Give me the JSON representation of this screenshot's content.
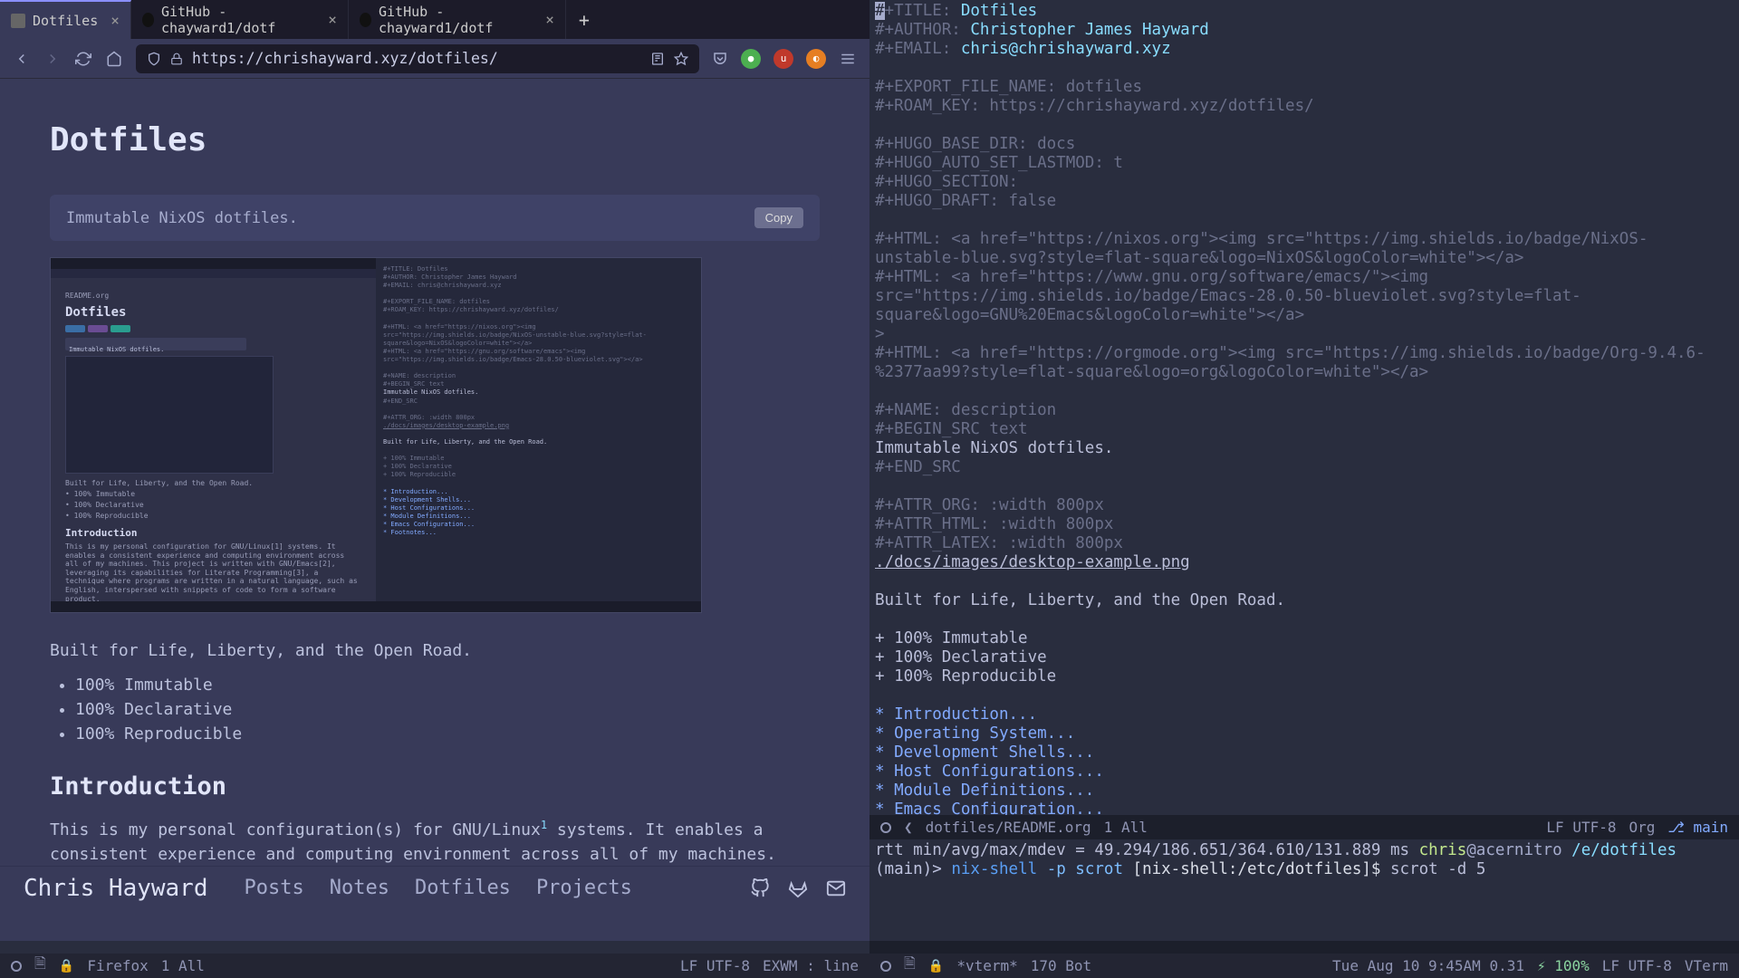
{
  "browser": {
    "tabs": [
      {
        "title": "Dotfiles",
        "active": true
      },
      {
        "title": "GitHub - chayward1/dotf",
        "active": false
      },
      {
        "title": "GitHub - chayward1/dotf",
        "active": false
      }
    ],
    "url": "https://chrishayward.xyz/dotfiles/"
  },
  "page": {
    "title": "Dotfiles",
    "desc": "Immutable NixOS dotfiles.",
    "copy_label": "Copy",
    "tagline": "Built for Life, Liberty, and the Open Road.",
    "bullets": [
      "100% Immutable",
      "100% Declarative",
      "100% Reproducible"
    ],
    "intro_heading": "Introduction",
    "intro_body_a": "This is my personal configuration(s) for GNU/Linux",
    "intro_sup": "1",
    "intro_body_b": " systems. It enables a consistent experience and computing environment across all of my machines. This"
  },
  "site_nav": {
    "brand": "Chris Hayward",
    "links": [
      "Posts",
      "Notes",
      "Dotfiles",
      "Projects"
    ]
  },
  "mini": {
    "readme": "README.org",
    "title": "Dotfiles",
    "desc": "Immutable NixOS dotfiles.",
    "tagline": "Built for Life, Liberty, and the Open Road.",
    "b1": "• 100% Immutable",
    "b2": "• 100% Declarative",
    "b3": "• 100% Reproducible",
    "intro": "Introduction",
    "para": "This is my personal configuration for GNU/Linux[1] systems. It enables a consistent experience and computing environment across all of my machines. This project is written with GNU/Emacs[2], leveraging its capabilities for Literate Programming[3], a technique where programs are written in a natural language, such as English, interspersed with snippets of code to form a software product."
  },
  "editor": {
    "title_key": "#+TITLE:",
    "title_val": "Dotfiles",
    "author_key": "#+AUTHOR:",
    "author_val": "Christopher James Hayward",
    "email_key": "#+EMAIL:",
    "email_val": "chris@chrishayward.xyz",
    "export": "#+EXPORT_FILE_NAME: dotfiles",
    "roam": "#+ROAM_KEY: https://chrishayward.xyz/dotfiles/",
    "hugo_base": "#+HUGO_BASE_DIR: docs",
    "hugo_last": "#+HUGO_AUTO_SET_LASTMOD: t",
    "hugo_section": "#+HUGO_SECTION:",
    "hugo_draft": "#+HUGO_DRAFT: false",
    "html1": "#+HTML: <a href=\"https://nixos.org\"><img src=\"https://img.shields.io/badge/NixOS-unstable-blue.svg?style=flat-square&logo=NixOS&logoColor=white\"></a>",
    "html2": "#+HTML: <a href=\"https://www.gnu.org/software/emacs/\"><img src=\"https://img.shields.io/badge/Emacs-28.0.50-blueviolet.svg?style=flat-square&logo=GNU%20Emacs&logoColor=white\"></a>",
    "html3": "#+HTML: <a href=\"https://orgmode.org\"><img src=\"https://img.shields.io/badge/Org-9.4.6-%2377aa99?style=flat-square&logo=org&logoColor=white\"></a>",
    "name": "#+NAME: description",
    "begin_src": "#+BEGIN_SRC text",
    "desc_line": "Immutable NixOS dotfiles.",
    "end_src": "#+END_SRC",
    "attr_org": "#+ATTR_ORG: :width 800px",
    "attr_html": "#+ATTR_HTML: :width 800px",
    "attr_latex": "#+ATTR_LATEX: :width 800px",
    "img_path": "./docs/images/desktop-example.png",
    "built": "Built for Life, Liberty, and the Open Road.",
    "plus1": "+ 100% Immutable",
    "plus2": "+ 100% Declarative",
    "plus3": "+ 100% Reproducible",
    "h1": "* Introduction...",
    "h2": "* Operating System...",
    "h3": "* Development Shells...",
    "h4": "* Host Configurations...",
    "h5": "* Module Definitions...",
    "h6": "* Emacs Configuration..."
  },
  "editor_status": {
    "file": "dotfiles/README.org",
    "pos": "1  All",
    "enc": "LF UTF-8",
    "mode": "Org",
    "branch": "⎇ main"
  },
  "vterm": {
    "rtt": "rtt min/avg/max/mdev = 49.294/186.651/364.610/131.889 ms",
    "user": "chris",
    "host": "@acernitro",
    "path": "/e/dotfiles",
    "branch": "(main)>",
    "cmd1": "nix-shell",
    "flag": "-p scrot",
    "nix_prompt": "[nix-shell:/etc/dotfiles]$",
    "cmd2": "scrot -d 5"
  },
  "vterm_status": {
    "name": "*vterm*",
    "pos": "170 Bot"
  },
  "bottom_left": {
    "name": "Firefox",
    "pos": "1 All",
    "enc": "LF UTF-8",
    "mode": "EXWM : line"
  },
  "bottom_right": {
    "time": "Tue Aug 10 9:45AM 0.31",
    "batt": "⚡ 100%",
    "enc": "LF UTF-8",
    "mode": "VTerm"
  }
}
